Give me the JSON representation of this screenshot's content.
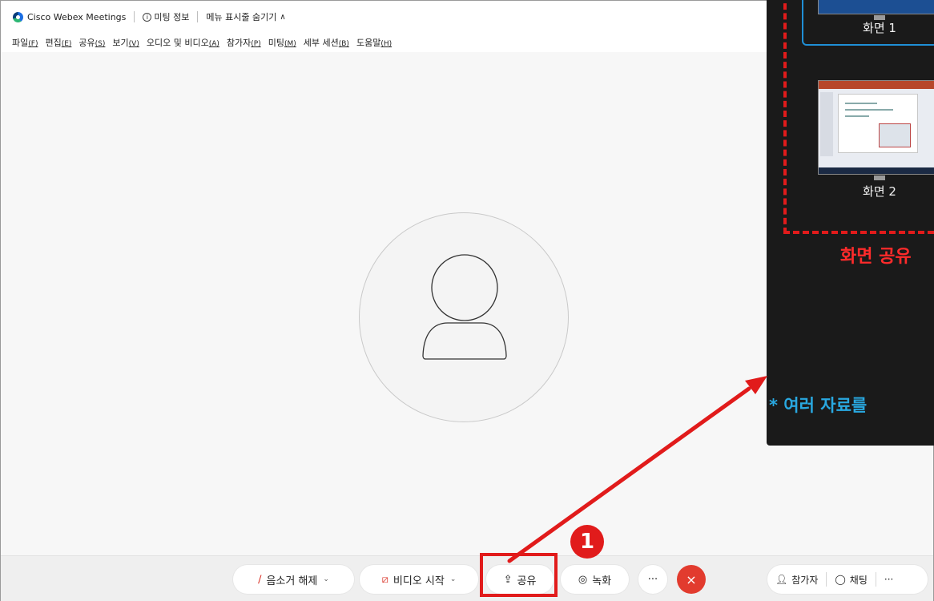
{
  "titlebar": {
    "app_name": "Cisco Webex Meetings",
    "meeting_info": "미팅 정보",
    "hide_menu": "메뉴 표시줄 숨기기"
  },
  "menubar": {
    "items": [
      {
        "label": "파일",
        "key": "(F)"
      },
      {
        "label": "편집",
        "key": "(E)"
      },
      {
        "label": "공유",
        "key": "(S)"
      },
      {
        "label": "보기",
        "key": "(V)"
      },
      {
        "label": "오디오 및 비디오",
        "key": "(A)"
      },
      {
        "label": "참가자",
        "key": "(P)"
      },
      {
        "label": "미팅",
        "key": "(M)"
      },
      {
        "label": "세부 세션",
        "key": "(B)"
      },
      {
        "label": "도움말",
        "key": "(H)"
      }
    ]
  },
  "controls": {
    "mute_label": "음소거 해제",
    "video_label": "비디오 시작",
    "share_label": "공유",
    "record_label": "녹화",
    "more_label": "···",
    "end_label": "×",
    "participants_label": "참가자",
    "chat_label": "채팅",
    "right_more_label": "···"
  },
  "annotation": {
    "step_number": "1",
    "screen1_label": "화면 1",
    "screen2_label": "화면 2",
    "title": "화면 공유",
    "note": "* 여러 자료를"
  },
  "colors": {
    "annotation_red": "#e11b1b",
    "note_blue": "#29a8e0",
    "end_button": "#e23b2e",
    "panel_bg": "#1a1a1a"
  },
  "icons": [
    "webex-logo-icon",
    "info-icon",
    "chevron-up-icon",
    "mic-muted-icon",
    "video-off-icon",
    "share-icon",
    "record-icon",
    "close-icon",
    "person-icon",
    "chat-icon",
    "avatar-placeholder-icon"
  ]
}
